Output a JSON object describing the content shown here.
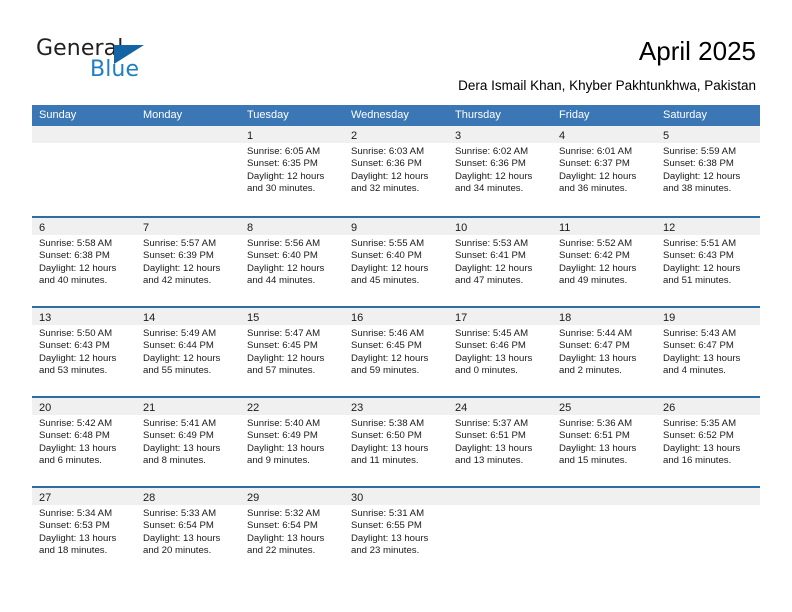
{
  "brand": {
    "name_part1": "General",
    "name_part2": "Blue",
    "triangle_icon": "triangle-icon",
    "accent_color": "#1464a5",
    "blue_text_color": "#1f7fc4"
  },
  "header": {
    "month_title": "April 2025",
    "location": "Dera Ismail Khan, Khyber Pakhtunkhwa, Pakistan"
  },
  "calendar": {
    "header_bg": "#3b77b5",
    "row_divider_color": "#2e6da4",
    "day_band_bg": "#f0f0f0",
    "weekdays": [
      "Sunday",
      "Monday",
      "Tuesday",
      "Wednesday",
      "Thursday",
      "Friday",
      "Saturday"
    ],
    "weeks": [
      [
        {
          "day": "",
          "lines": []
        },
        {
          "day": "",
          "lines": []
        },
        {
          "day": "1",
          "lines": [
            "Sunrise: 6:05 AM",
            "Sunset: 6:35 PM",
            "Daylight: 12 hours",
            "and 30 minutes."
          ]
        },
        {
          "day": "2",
          "lines": [
            "Sunrise: 6:03 AM",
            "Sunset: 6:36 PM",
            "Daylight: 12 hours",
            "and 32 minutes."
          ]
        },
        {
          "day": "3",
          "lines": [
            "Sunrise: 6:02 AM",
            "Sunset: 6:36 PM",
            "Daylight: 12 hours",
            "and 34 minutes."
          ]
        },
        {
          "day": "4",
          "lines": [
            "Sunrise: 6:01 AM",
            "Sunset: 6:37 PM",
            "Daylight: 12 hours",
            "and 36 minutes."
          ]
        },
        {
          "day": "5",
          "lines": [
            "Sunrise: 5:59 AM",
            "Sunset: 6:38 PM",
            "Daylight: 12 hours",
            "and 38 minutes."
          ]
        }
      ],
      [
        {
          "day": "6",
          "lines": [
            "Sunrise: 5:58 AM",
            "Sunset: 6:38 PM",
            "Daylight: 12 hours",
            "and 40 minutes."
          ]
        },
        {
          "day": "7",
          "lines": [
            "Sunrise: 5:57 AM",
            "Sunset: 6:39 PM",
            "Daylight: 12 hours",
            "and 42 minutes."
          ]
        },
        {
          "day": "8",
          "lines": [
            "Sunrise: 5:56 AM",
            "Sunset: 6:40 PM",
            "Daylight: 12 hours",
            "and 44 minutes."
          ]
        },
        {
          "day": "9",
          "lines": [
            "Sunrise: 5:55 AM",
            "Sunset: 6:40 PM",
            "Daylight: 12 hours",
            "and 45 minutes."
          ]
        },
        {
          "day": "10",
          "lines": [
            "Sunrise: 5:53 AM",
            "Sunset: 6:41 PM",
            "Daylight: 12 hours",
            "and 47 minutes."
          ]
        },
        {
          "day": "11",
          "lines": [
            "Sunrise: 5:52 AM",
            "Sunset: 6:42 PM",
            "Daylight: 12 hours",
            "and 49 minutes."
          ]
        },
        {
          "day": "12",
          "lines": [
            "Sunrise: 5:51 AM",
            "Sunset: 6:43 PM",
            "Daylight: 12 hours",
            "and 51 minutes."
          ]
        }
      ],
      [
        {
          "day": "13",
          "lines": [
            "Sunrise: 5:50 AM",
            "Sunset: 6:43 PM",
            "Daylight: 12 hours",
            "and 53 minutes."
          ]
        },
        {
          "day": "14",
          "lines": [
            "Sunrise: 5:49 AM",
            "Sunset: 6:44 PM",
            "Daylight: 12 hours",
            "and 55 minutes."
          ]
        },
        {
          "day": "15",
          "lines": [
            "Sunrise: 5:47 AM",
            "Sunset: 6:45 PM",
            "Daylight: 12 hours",
            "and 57 minutes."
          ]
        },
        {
          "day": "16",
          "lines": [
            "Sunrise: 5:46 AM",
            "Sunset: 6:45 PM",
            "Daylight: 12 hours",
            "and 59 minutes."
          ]
        },
        {
          "day": "17",
          "lines": [
            "Sunrise: 5:45 AM",
            "Sunset: 6:46 PM",
            "Daylight: 13 hours",
            "and 0 minutes."
          ]
        },
        {
          "day": "18",
          "lines": [
            "Sunrise: 5:44 AM",
            "Sunset: 6:47 PM",
            "Daylight: 13 hours",
            "and 2 minutes."
          ]
        },
        {
          "day": "19",
          "lines": [
            "Sunrise: 5:43 AM",
            "Sunset: 6:47 PM",
            "Daylight: 13 hours",
            "and 4 minutes."
          ]
        }
      ],
      [
        {
          "day": "20",
          "lines": [
            "Sunrise: 5:42 AM",
            "Sunset: 6:48 PM",
            "Daylight: 13 hours",
            "and 6 minutes."
          ]
        },
        {
          "day": "21",
          "lines": [
            "Sunrise: 5:41 AM",
            "Sunset: 6:49 PM",
            "Daylight: 13 hours",
            "and 8 minutes."
          ]
        },
        {
          "day": "22",
          "lines": [
            "Sunrise: 5:40 AM",
            "Sunset: 6:49 PM",
            "Daylight: 13 hours",
            "and 9 minutes."
          ]
        },
        {
          "day": "23",
          "lines": [
            "Sunrise: 5:38 AM",
            "Sunset: 6:50 PM",
            "Daylight: 13 hours",
            "and 11 minutes."
          ]
        },
        {
          "day": "24",
          "lines": [
            "Sunrise: 5:37 AM",
            "Sunset: 6:51 PM",
            "Daylight: 13 hours",
            "and 13 minutes."
          ]
        },
        {
          "day": "25",
          "lines": [
            "Sunrise: 5:36 AM",
            "Sunset: 6:51 PM",
            "Daylight: 13 hours",
            "and 15 minutes."
          ]
        },
        {
          "day": "26",
          "lines": [
            "Sunrise: 5:35 AM",
            "Sunset: 6:52 PM",
            "Daylight: 13 hours",
            "and 16 minutes."
          ]
        }
      ],
      [
        {
          "day": "27",
          "lines": [
            "Sunrise: 5:34 AM",
            "Sunset: 6:53 PM",
            "Daylight: 13 hours",
            "and 18 minutes."
          ]
        },
        {
          "day": "28",
          "lines": [
            "Sunrise: 5:33 AM",
            "Sunset: 6:54 PM",
            "Daylight: 13 hours",
            "and 20 minutes."
          ]
        },
        {
          "day": "29",
          "lines": [
            "Sunrise: 5:32 AM",
            "Sunset: 6:54 PM",
            "Daylight: 13 hours",
            "and 22 minutes."
          ]
        },
        {
          "day": "30",
          "lines": [
            "Sunrise: 5:31 AM",
            "Sunset: 6:55 PM",
            "Daylight: 13 hours",
            "and 23 minutes."
          ]
        },
        {
          "day": "",
          "lines": []
        },
        {
          "day": "",
          "lines": []
        },
        {
          "day": "",
          "lines": []
        }
      ]
    ]
  }
}
